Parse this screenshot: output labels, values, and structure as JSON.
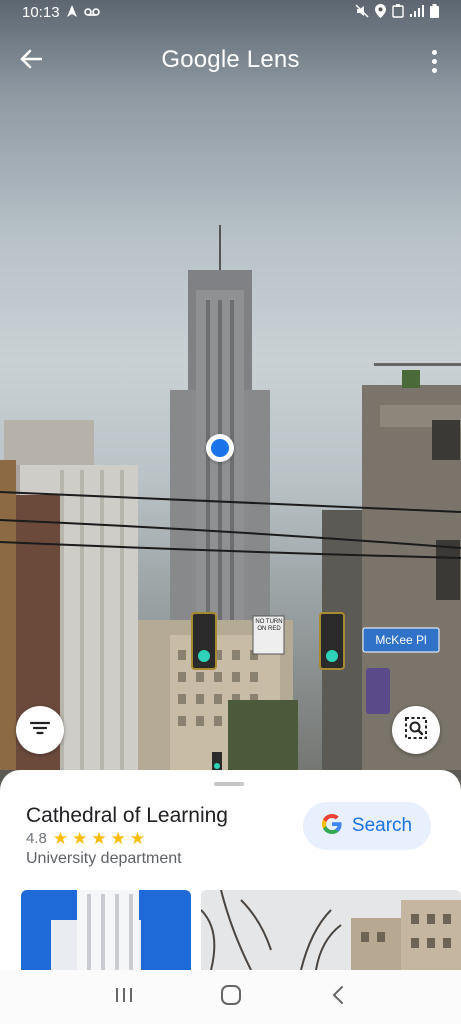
{
  "status_bar": {
    "time": "10:13",
    "icons": [
      "navigation-icon",
      "voicemail-icon",
      "mute-icon",
      "location-icon",
      "wifi-icon",
      "signal-icon",
      "battery-icon"
    ]
  },
  "top_bar": {
    "title": "Google Lens",
    "back_icon": "arrow-left-icon",
    "more_icon": "more-vert-icon"
  },
  "scene": {
    "signs": {
      "no_turn": "NO TURN ON RED",
      "street": "McKee Pl"
    }
  },
  "controls": {
    "filter_icon": "filter-icon",
    "region_icon": "select-region-icon"
  },
  "result": {
    "title": "Cathedral of Learning",
    "rating": "4.8",
    "stars": 5,
    "category": "University department",
    "search_button": "Search"
  },
  "colors": {
    "accent": "#1a73e8",
    "star": "#fbbc04",
    "search_bg": "#e8f0fe"
  },
  "nav_bar": {
    "icons": [
      "recents-icon",
      "home-icon",
      "back-icon"
    ]
  }
}
